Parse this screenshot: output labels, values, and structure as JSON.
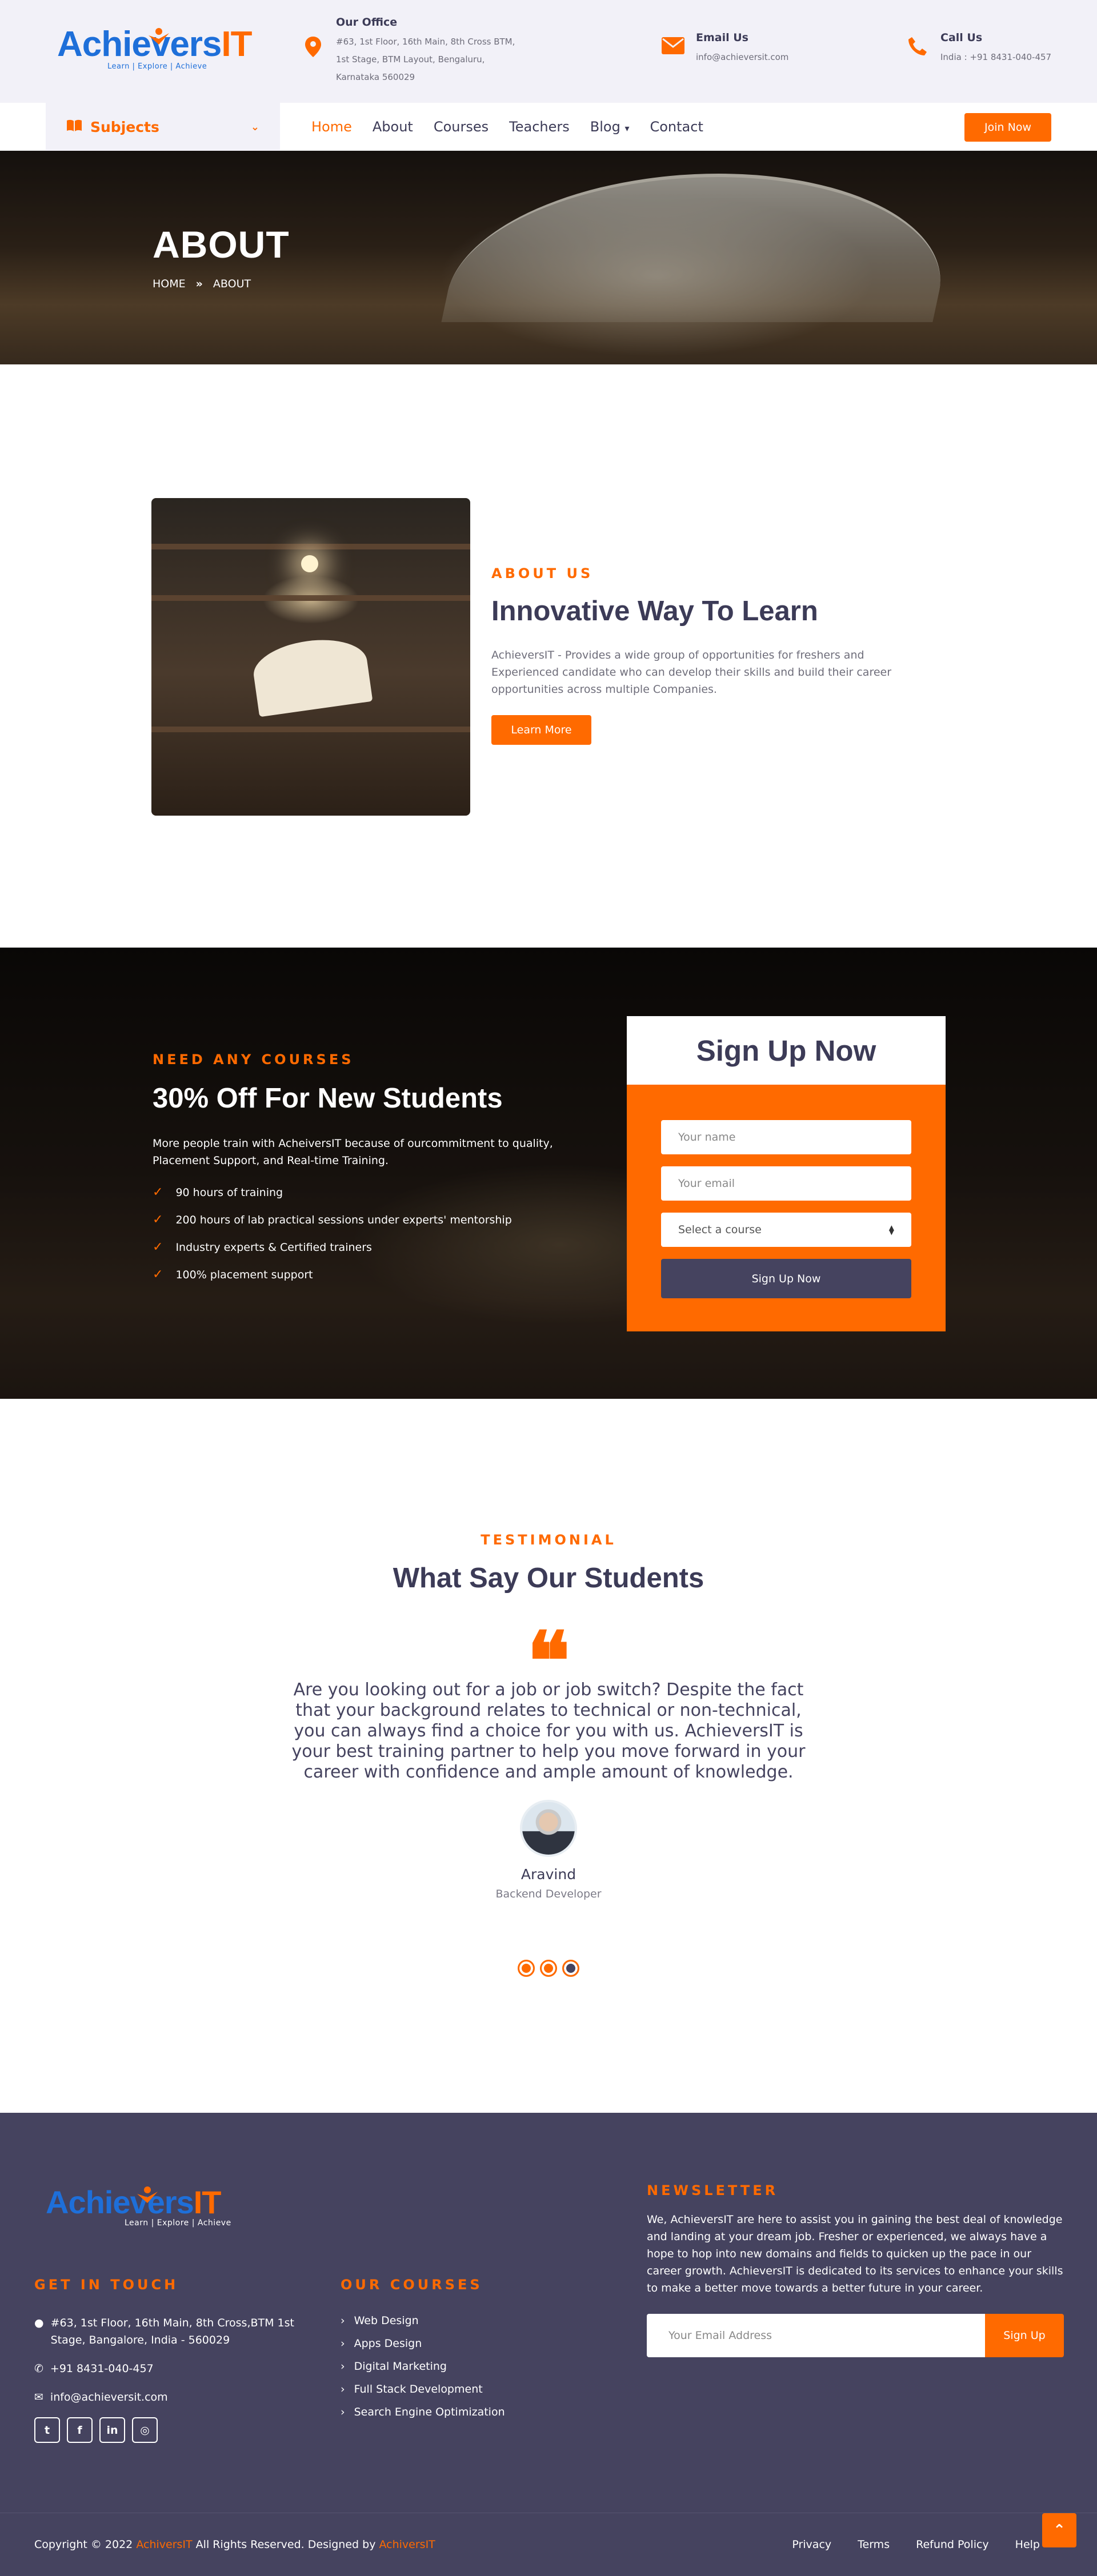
{
  "brand": {
    "logo_main": "Achievers",
    "logo_it": "IT",
    "logo_tagline": "Learn | Explore | Achieve"
  },
  "topbar": {
    "office": {
      "title": "Our Office",
      "text": "#63, 1st Floor, 16th Main, 8th Cross BTM, 1st Stage, BTM Layout, Bengaluru, Karnataka 560029",
      "icon": "map-marker-icon"
    },
    "email": {
      "title": "Email Us",
      "text": "info@achieversit.com",
      "icon": "envelope-icon"
    },
    "call": {
      "title": "Call Us",
      "text": "India : +91 8431-040-457",
      "icon": "phone-icon"
    }
  },
  "nav": {
    "subjects_label": "Subjects",
    "links": [
      "Home",
      "About",
      "Courses",
      "Teachers",
      "Blog",
      "Contact"
    ],
    "blog_caret": "▾",
    "join_label": "Join Now"
  },
  "banner": {
    "title": "ABOUT",
    "crumb_home": "HOME",
    "crumb_sep": "»",
    "crumb_current": "ABOUT"
  },
  "about": {
    "eyebrow": "ABOUT US",
    "title": "Innovative Way To Learn",
    "text": "AchieversIT - Provides a wide group of opportunities for freshers and Experienced candidate who can develop their skills and build their career opportunities across multiple Companies.",
    "button": "Learn More"
  },
  "offer": {
    "eyebrow": "NEED ANY COURSES",
    "title": "30% Off For New Students",
    "text": "More people train with AcheiversIT because of ourcommitment to quality, Placement Support, and Real-time Training.",
    "bullets": [
      "90 hours of training",
      "200 hours of lab practical sessions under experts' mentorship",
      "Industry experts & Certified trainers",
      "100% placement support"
    ],
    "form": {
      "title": "Sign Up Now",
      "name_placeholder": "Your name",
      "email_placeholder": "Your email",
      "course_select": "Select a course",
      "submit": "Sign Up Now"
    }
  },
  "testimonial": {
    "eyebrow": "TESTIMONIAL",
    "title": "What Say Our Students",
    "quote_mark": "❝",
    "text": "Are you looking out for a job or job switch? Despite the fact that your background relates to technical or non-technical, you can always find a choice for you with us. AchieversIT is your best training partner to help you move forward in your career with confidence and ample amount of knowledge.",
    "name": "Aravind",
    "role": "Backend Developer",
    "active_slide": 3,
    "slide_count": 3
  },
  "footer": {
    "get_in_touch": "GET IN TOUCH",
    "address": "#63, 1st Floor, 16th Main, 8th Cross,BTM 1st Stage, Bangalore, India - 560029",
    "phone": "+91 8431-040-457",
    "email": "info@achieversit.com",
    "socials": [
      "twitter-icon",
      "facebook-icon",
      "linkedin-icon",
      "instagram-icon"
    ],
    "courses_title": "OUR COURSES",
    "courses": [
      "Web Design",
      "Apps Design",
      "Digital Marketing",
      "Full Stack Development",
      "Search Engine Optimization"
    ],
    "newsletter_title": "NEWSLETTER",
    "newsletter_text": "We, AchieversIT are here to assist you in gaining the best deal of knowledge and landing at your dream job. Fresher or experienced, we always have a hope to hop into new domains and fields to quicken up the pace in our career growth. AchieversIT is dedicated to its services to enhance your skills to make a better move towards a better future in your career.",
    "newsletter_placeholder": "Your Email Address",
    "newsletter_button": "Sign Up",
    "copyright_prefix": "Copyright © 2022",
    "copyright_brand": "AchiversIT",
    "copyright_mid": "All Rights Reserved. Designed by",
    "copyright_designer": "AchiversIT",
    "bottom_links": [
      "Privacy",
      "Terms",
      "Refund Policy",
      "Help"
    ]
  },
  "colors": {
    "accent": "#ff6a00",
    "dark": "#45435f",
    "heading": "#3c3b57",
    "brand_blue": "#1e6fd9"
  }
}
